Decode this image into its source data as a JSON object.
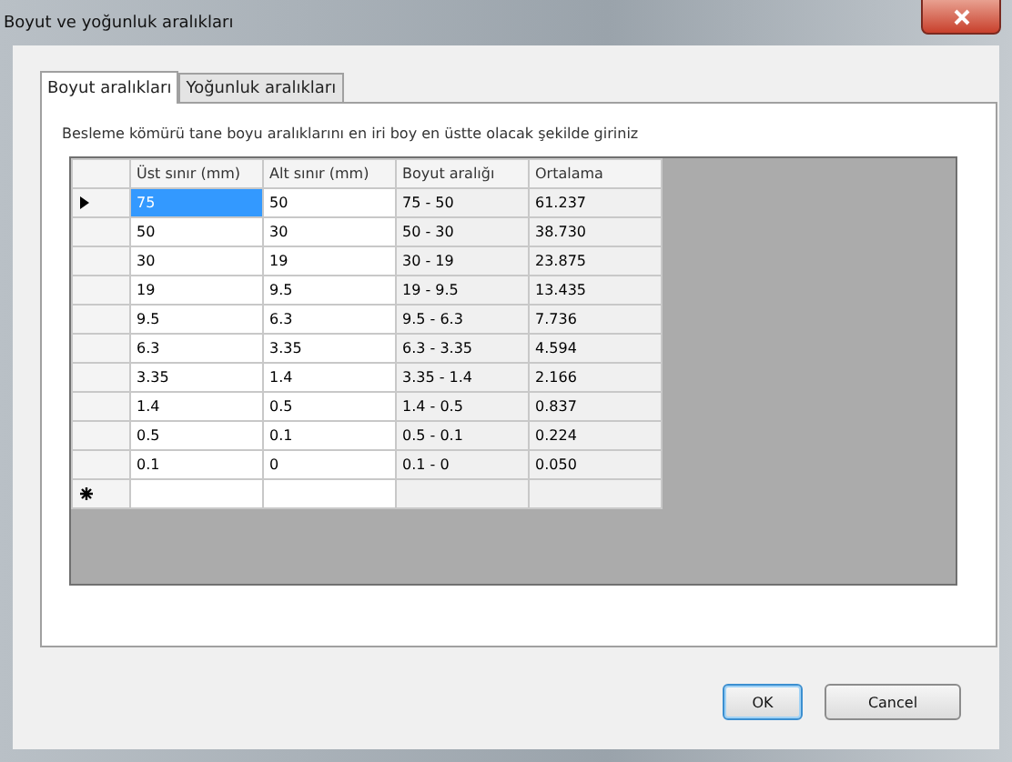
{
  "window": {
    "title": "Boyut ve yoğunluk aralıkları"
  },
  "tabs": [
    {
      "label": "Boyut aralıkları",
      "selected": true
    },
    {
      "label": "Yoğunluk aralıkları",
      "selected": false
    }
  ],
  "instruction": "Besleme kömürü tane boyu aralıklarını en iri boy en üstte olacak şekilde giriniz",
  "grid": {
    "columns": [
      {
        "label": "Üst sınır (mm)",
        "readonly": false
      },
      {
        "label": "Alt sınır (mm)",
        "readonly": false
      },
      {
        "label": "Boyut aralığı",
        "readonly": true
      },
      {
        "label": "Ortalama",
        "readonly": true
      }
    ],
    "rows": [
      {
        "current": true,
        "cells": [
          {
            "text": "75",
            "selected": true
          },
          {
            "text": "50",
            "selected": false
          },
          {
            "text": "75 - 50",
            "selected": false
          },
          {
            "text": "61.237",
            "selected": false
          }
        ]
      },
      {
        "current": false,
        "cells": [
          {
            "text": "50",
            "selected": false
          },
          {
            "text": "30",
            "selected": false
          },
          {
            "text": "50 - 30",
            "selected": false
          },
          {
            "text": "38.730",
            "selected": false
          }
        ]
      },
      {
        "current": false,
        "cells": [
          {
            "text": "30",
            "selected": false
          },
          {
            "text": "19",
            "selected": false
          },
          {
            "text": "30 - 19",
            "selected": false
          },
          {
            "text": "23.875",
            "selected": false
          }
        ]
      },
      {
        "current": false,
        "cells": [
          {
            "text": "19",
            "selected": false
          },
          {
            "text": "9.5",
            "selected": false
          },
          {
            "text": "19 - 9.5",
            "selected": false
          },
          {
            "text": "13.435",
            "selected": false
          }
        ]
      },
      {
        "current": false,
        "cells": [
          {
            "text": "9.5",
            "selected": false
          },
          {
            "text": "6.3",
            "selected": false
          },
          {
            "text": "9.5 - 6.3",
            "selected": false
          },
          {
            "text": "7.736",
            "selected": false
          }
        ]
      },
      {
        "current": false,
        "cells": [
          {
            "text": "6.3",
            "selected": false
          },
          {
            "text": "3.35",
            "selected": false
          },
          {
            "text": "6.3 - 3.35",
            "selected": false
          },
          {
            "text": "4.594",
            "selected": false
          }
        ]
      },
      {
        "current": false,
        "cells": [
          {
            "text": "3.35",
            "selected": false
          },
          {
            "text": "1.4",
            "selected": false
          },
          {
            "text": "3.35 - 1.4",
            "selected": false
          },
          {
            "text": "2.166",
            "selected": false
          }
        ]
      },
      {
        "current": false,
        "cells": [
          {
            "text": "1.4",
            "selected": false
          },
          {
            "text": "0.5",
            "selected": false
          },
          {
            "text": "1.4 - 0.5",
            "selected": false
          },
          {
            "text": "0.837",
            "selected": false
          }
        ]
      },
      {
        "current": false,
        "cells": [
          {
            "text": "0.5",
            "selected": false
          },
          {
            "text": "0.1",
            "selected": false
          },
          {
            "text": "0.5 - 0.1",
            "selected": false
          },
          {
            "text": "0.224",
            "selected": false
          }
        ]
      },
      {
        "current": false,
        "cells": [
          {
            "text": "0.1",
            "selected": false
          },
          {
            "text": "0",
            "selected": false
          },
          {
            "text": "0.1 - 0",
            "selected": false
          },
          {
            "text": "0.050",
            "selected": false
          }
        ]
      }
    ],
    "new_row": true
  },
  "buttons": [
    {
      "label": "OK",
      "default": true
    },
    {
      "label": "Cancel",
      "default": false
    }
  ]
}
